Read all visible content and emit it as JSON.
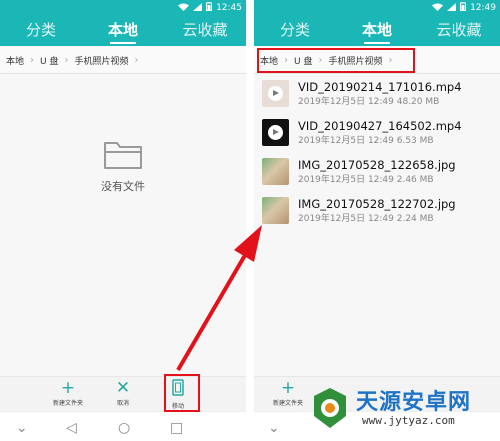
{
  "left": {
    "status": {
      "time": "12:45"
    },
    "tabs": [
      "分类",
      "本地",
      "云收藏"
    ],
    "active_tab": 1,
    "breadcrumb": [
      "本地",
      "U 盘",
      "手机照片视频"
    ],
    "empty_text": "没有文件",
    "toolbar": [
      {
        "label": "新建文件夹",
        "icon": "plus-icon"
      },
      {
        "label": "取消",
        "icon": "close-icon"
      },
      {
        "label": "移动",
        "icon": "move-icon"
      }
    ]
  },
  "right": {
    "status": {
      "time": "12:49"
    },
    "tabs": [
      "分类",
      "本地",
      "云收藏"
    ],
    "active_tab": 1,
    "breadcrumb": [
      "本地",
      "U 盘",
      "手机照片视频"
    ],
    "files": [
      {
        "name": "VID_20190214_171016.mp4",
        "meta": "2019年12月5日 12:49 48.20 MB",
        "thumb": "video-light"
      },
      {
        "name": "VID_20190427_164502.mp4",
        "meta": "2019年12月5日 12:49 6.53 MB",
        "thumb": "video-dark"
      },
      {
        "name": "IMG_20170528_122658.jpg",
        "meta": "2019年12月5日 12:49 2.46 MB",
        "thumb": "photo"
      },
      {
        "name": "IMG_20170528_122702.jpg",
        "meta": "2019年12月5日 12:49 2.24 MB",
        "thumb": "photo"
      }
    ],
    "toolbar": [
      {
        "label": "新建文件夹",
        "icon": "plus-icon"
      }
    ]
  },
  "watermark": {
    "brand": "天源安卓网",
    "url": "www.jytyaz.com"
  },
  "colors": {
    "header": "#1bb6b6",
    "accent": "#2aa6a6",
    "highlight": "#e3121a"
  }
}
